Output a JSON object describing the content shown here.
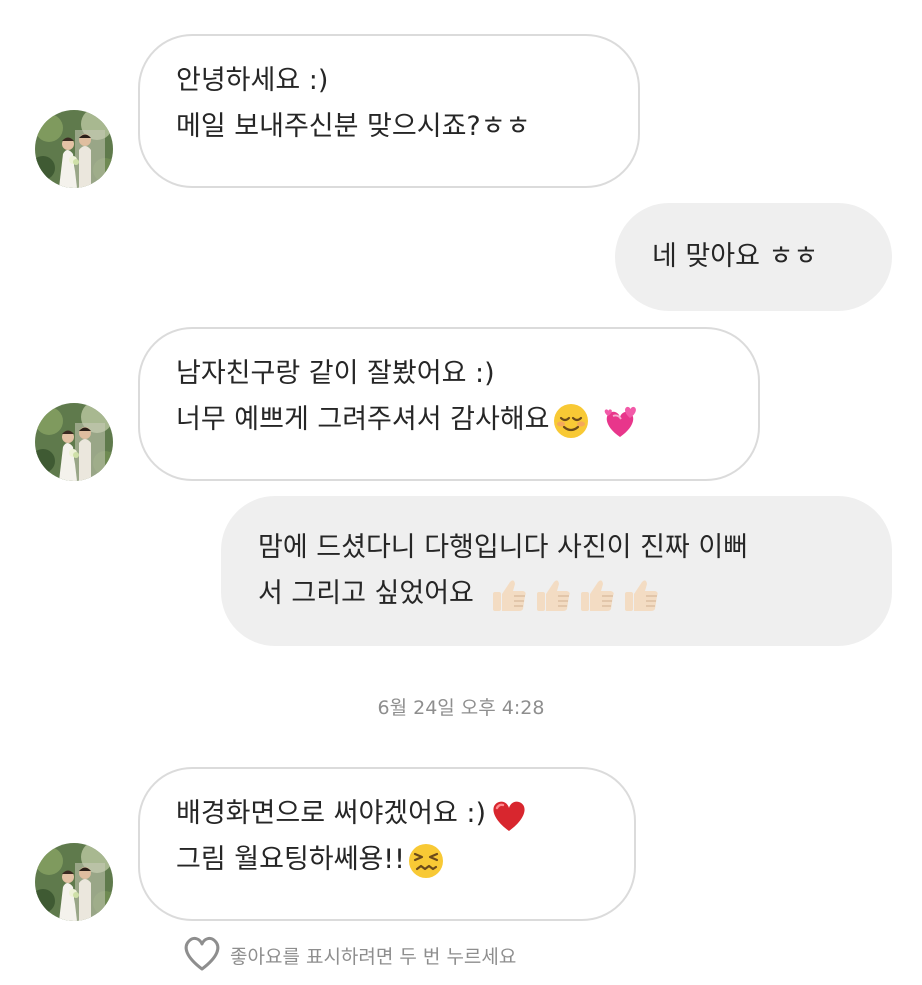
{
  "messages": [
    {
      "direction": "incoming",
      "lines": [
        "안녕하세요 :)",
        "메일 보내주신분 맞으시죠?ㅎㅎ"
      ]
    },
    {
      "direction": "outgoing",
      "lines": [
        "네 맞아요 ㅎㅎ"
      ]
    },
    {
      "direction": "incoming",
      "lines": [
        "남자친구랑 같이 잘봤어요 :)",
        "너무 예쁘게 그려주셔서 감사해요"
      ],
      "emojis": [
        "relieved-face-emoji",
        "revolving-hearts-emoji"
      ]
    },
    {
      "direction": "outgoing",
      "lines": [
        "맘에 드셨다니 다행입니다  사진이 진짜 이뻐",
        "서 그리고 싶었어요"
      ],
      "emojis": [
        "thumbs-up-emoji",
        "thumbs-up-emoji",
        "thumbs-up-emoji",
        "thumbs-up-emoji"
      ]
    },
    {
      "direction": "incoming",
      "lines": [
        "배경화면으로 써야겠어요 :)",
        "그림 월요팅하쎄용!!"
      ],
      "emojis": [
        "red-heart-emoji",
        "confounded-face-emoji"
      ]
    }
  ],
  "timestamp": "6월 24일 오후 4:28",
  "like_hint": "좋아요를 표시하려면 두 번 누르세요",
  "colors": {
    "incoming_border": "#dbdbdb",
    "outgoing_background": "#efefef",
    "text": "#262626",
    "meta_text": "#8e8e8e"
  },
  "icons": {
    "like": "heart-outline-icon"
  }
}
